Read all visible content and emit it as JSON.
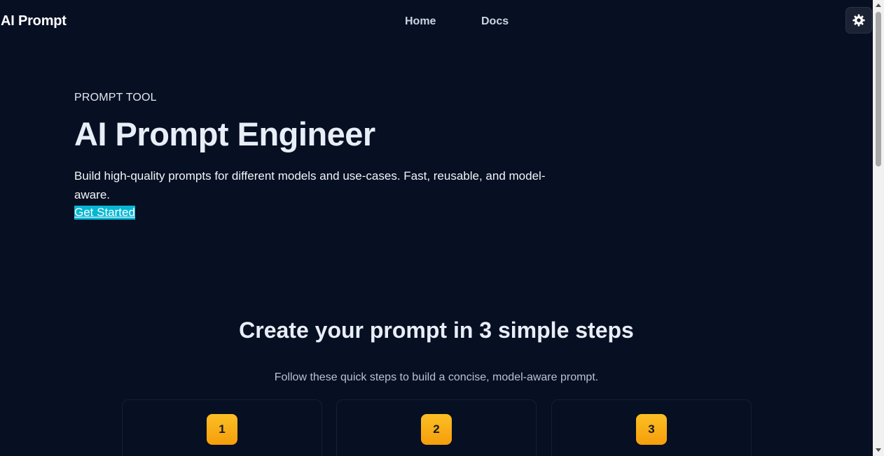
{
  "header": {
    "brand": "AI Prompt",
    "nav": [
      "Home",
      "Docs"
    ],
    "theme_toggle_icon": "sun-gear-icon"
  },
  "hero": {
    "eyebrow": "PROMPT TOOL",
    "title": "AI Prompt Engineer",
    "description": "Build high-quality prompts for different models and use-cases. Fast, reusable, and model-aware.",
    "cta_label": "Get Started"
  },
  "steps_section": {
    "title": "Create your prompt in 3 simple steps",
    "subtitle": "Follow these quick steps to build a concise, model-aware prompt.",
    "steps": [
      {
        "number": "1"
      },
      {
        "number": "2"
      },
      {
        "number": "3"
      }
    ]
  },
  "colors": {
    "background": "#070f22",
    "accent_cyan": "#06b6d4",
    "step_badge": "#fbbf24",
    "text_muted": "#b8c2d3"
  }
}
